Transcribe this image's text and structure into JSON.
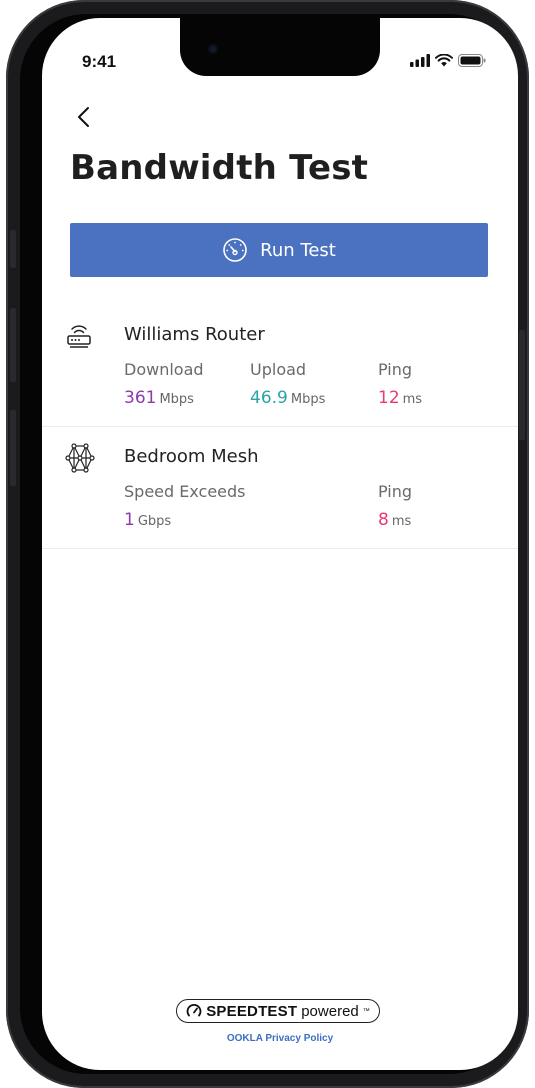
{
  "status_bar": {
    "time": "9:41"
  },
  "header": {
    "title": "Bandwidth Test"
  },
  "run_button": {
    "label": "Run Test"
  },
  "devices": [
    {
      "name": "Williams Router",
      "icon": "router-icon",
      "metrics": [
        {
          "label": "Download",
          "value": "361",
          "unit": "Mbps",
          "color": "#8e3aa8"
        },
        {
          "label": "Upload",
          "value": "46.9",
          "unit": "Mbps",
          "color": "#2aa4a8"
        },
        {
          "label": "Ping",
          "value": "12",
          "unit": "ms",
          "color": "#e8397c"
        }
      ]
    },
    {
      "name": "Bedroom Mesh",
      "icon": "mesh-network-icon",
      "metrics": [
        {
          "label": "Speed Exceeds",
          "value": "1",
          "unit": "Gbps",
          "color": "#8e3aa8"
        },
        {
          "label": "Ping",
          "value": "8",
          "unit": "ms",
          "color": "#e8397c"
        }
      ]
    }
  ],
  "footer": {
    "badge_bold": "SPEEDTEST",
    "badge_light": "powered",
    "badge_tm": "™",
    "privacy_link": "OOKLA Privacy Policy"
  },
  "colors": {
    "accent": "#4a72c0",
    "download": "#8e3aa8",
    "upload": "#2aa4a8",
    "ping": "#e8397c"
  }
}
